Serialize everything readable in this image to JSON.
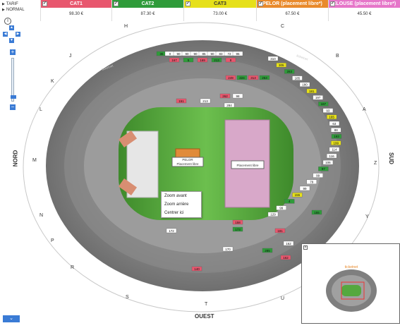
{
  "tarif": {
    "title": "TARIF",
    "subtitle": "NORMAL"
  },
  "categories": [
    {
      "name": "CAT1",
      "price": "98.30 €",
      "color": "#e8576e"
    },
    {
      "name": "CAT2",
      "price": "87.30 €",
      "color": "#2f9b3a"
    },
    {
      "name": "CAT3",
      "price": "73.00 €",
      "color": "#e6e01a"
    },
    {
      "name": "PELOR (placement libre*)",
      "price": "67.50 €",
      "color": "#e98a2b"
    },
    {
      "name": "ELOUSE (placement libre*)",
      "price": "45.50 €",
      "color": "#e676c9"
    }
  ],
  "colors": {
    "accent": "#3a7bd5",
    "field": "#55a83f",
    "ring": "#7f7f7f"
  },
  "icons": {
    "info": "info-icon",
    "up": "arrow-up-icon",
    "down": "arrow-down-icon",
    "left": "arrow-left-icon",
    "right": "arrow-right-icon",
    "zoom_in": "plus-icon",
    "zoom_out": "minus-icon"
  },
  "directions": {
    "H": "H",
    "C": "C",
    "J": "J",
    "B": "B",
    "K": "K",
    "L": "L",
    "A": "A",
    "M": "M",
    "Z": "Z",
    "N": "N",
    "Y": "Y",
    "P": "P",
    "R": "R",
    "S": "S",
    "T": "T",
    "U": "U"
  },
  "sides": {
    "north": "NORD",
    "south": "SUD",
    "west": "OUEST"
  },
  "pitch": {
    "pelouse_label": "PELOR",
    "pelouse_sub": "Placement libre",
    "fosse_label": "Placement libre"
  },
  "context_menu": {
    "zoom_in": "Zoom avant",
    "zoom_out": "Zoom arrière",
    "center": "Centrer ici"
  },
  "brand": "ticketnet",
  "sections": {
    "top_row1": [
      "36",
      "0",
      "90",
      "90",
      "90",
      "85",
      "90",
      "83",
      "72",
      "95"
    ],
    "top_row2": [
      "167",
      "5",
      "169",
      "213",
      "8"
    ],
    "top_row3": [
      "249",
      "224",
      "313",
      "253"
    ],
    "top_row4": [
      "262",
      "98"
    ],
    "top_row5": [
      "151",
      "213",
      "284"
    ],
    "right_col": [
      "310",
      "305",
      "283",
      "185",
      "180",
      "181",
      "197",
      "187",
      "93",
      "165",
      "63",
      "88",
      "193",
      "199",
      "114",
      "116",
      "106",
      "97",
      "99",
      "79",
      "99",
      "155",
      "4",
      "99",
      "129"
    ],
    "bottom_rows": [
      "158",
      "172",
      "173",
      "181",
      "170",
      "285",
      "140",
      "162",
      "155",
      "162"
    ]
  }
}
